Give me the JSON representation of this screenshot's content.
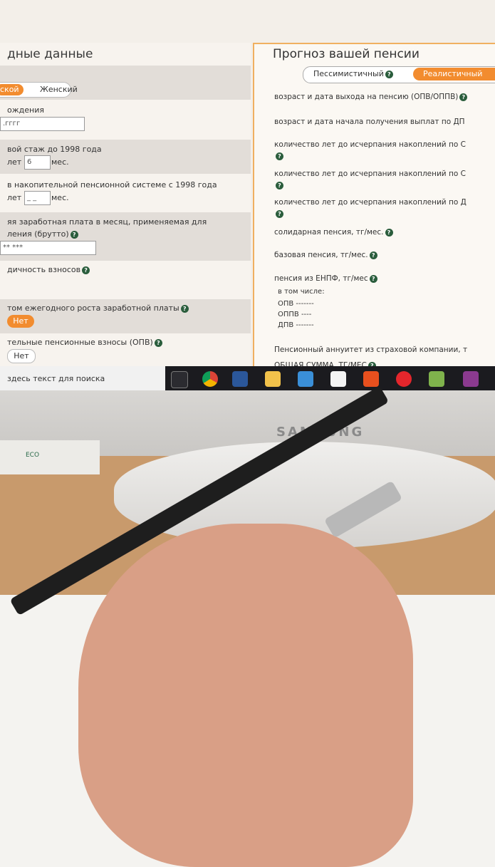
{
  "left_panel": {
    "title": "дные данные",
    "gender_selected": "ской",
    "gender_other": "Женский",
    "birth_label": "ождения",
    "birth_placeholder": ".гггг",
    "stazh_label": "вой стаж до 1998 года",
    "stazh_years_label": "лет",
    "stazh_years_value": "6",
    "stazh_months_label": "мес.",
    "nakop_label": "в накопительной пенсионной системе с 1998 года",
    "nakop_years_label": "лет",
    "nakop_years_value": "_ _",
    "nakop_months_label": "мес.",
    "salary_label_1": "яя заработная плата в месяц, применяемая для",
    "salary_label_2": "ления (брутто)",
    "salary_placeholder": "** ***",
    "period_label": "дичность взносов",
    "growth_label": "том ежегодного роста заработной платы",
    "growth_btn": "Нет",
    "opv_label": "тельные пенсионные взносы (ОПВ)",
    "opv_btn": "Нет"
  },
  "right_panel": {
    "title": "Прогноз вашей пенсии",
    "tab_pessimistic": "Пессимистичный",
    "tab_realistic": "Реалистичный",
    "lines": [
      "возраст и дата выхода на пенсию (ОПВ/ОППВ)",
      "возраст и дата начала получения выплат по ДП",
      "количество лет до исчерпания накоплений по С",
      "количество лет до исчерпания накоплений по С",
      "количество лет до исчерпания накоплений по Д",
      "солидарная пенсия, тг/мес.",
      "базовая пенсия, тг/мес.",
      "пенсия из ЕНПФ, тг/мес"
    ],
    "sub_caption": "в том числе:",
    "sub_items": [
      "ОПВ -------",
      "ОППВ ----",
      "ДПВ -------"
    ],
    "annuity": "Пенсионный аннуитет из страховой компании, т",
    "total": "ОБЩАЯ СУММА, ТГ/МЕС"
  },
  "taskbar": {
    "search_placeholder": "здесь текст для поиска",
    "icons": [
      "task-view-icon",
      "chrome-icon",
      "word-icon",
      "explorer-icon",
      "network-icon",
      "notepad-icon",
      "app-icon",
      "opera-icon",
      "paint-icon",
      "archive-icon"
    ]
  },
  "monitor": {
    "brand": "SAMSUNG"
  },
  "box_label": "ECO"
}
